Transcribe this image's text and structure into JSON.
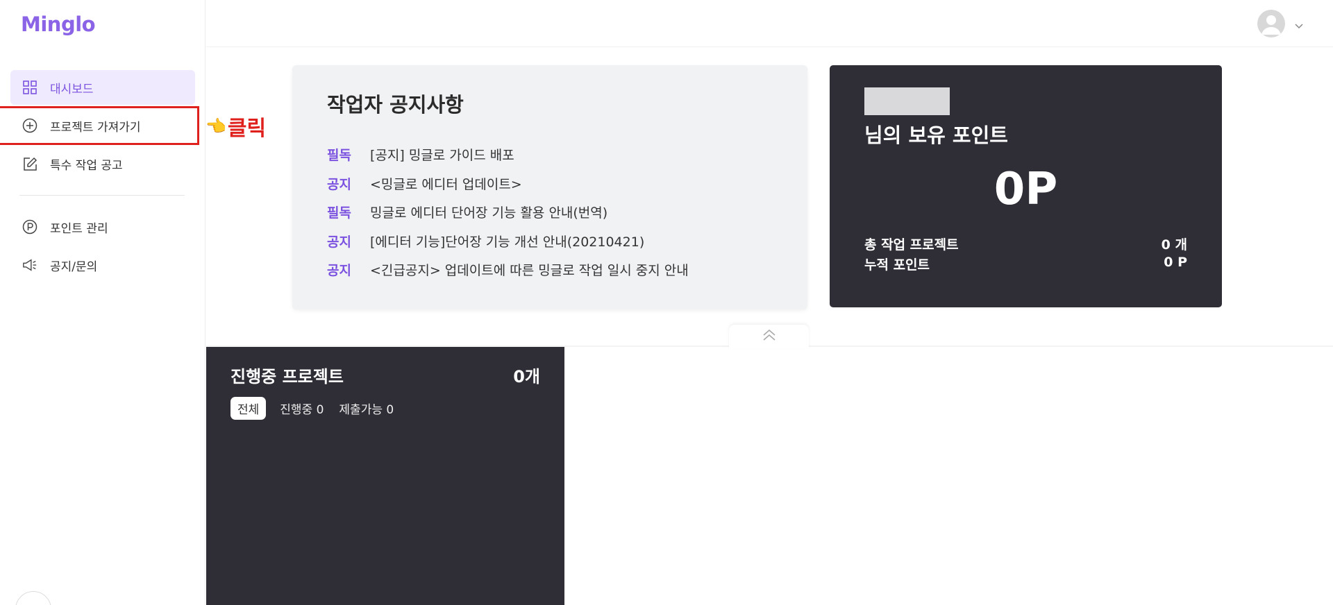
{
  "app": {
    "logo": "Minglo"
  },
  "sidebar": {
    "items": [
      {
        "label": "대시보드",
        "icon": "grid-icon"
      },
      {
        "label": "프로젝트 가져가기",
        "icon": "plus-circle-icon"
      },
      {
        "label": "특수 작업 공고",
        "icon": "edit-icon"
      },
      {
        "label": "포인트 관리",
        "icon": "p-circle-icon"
      },
      {
        "label": "공지/문의",
        "icon": "megaphone-icon"
      }
    ]
  },
  "annotation": {
    "hand": "👈",
    "label": "클릭",
    "color": "#e0201d"
  },
  "notices": {
    "title": "작업자 공지사항",
    "items": [
      {
        "tag": "필독",
        "text": "[공지] 밍글로 가이드 배포"
      },
      {
        "tag": "공지",
        "text": "<밍글로 에디터 업데이트>"
      },
      {
        "tag": "필독",
        "text": "밍글로 에디터 단어장 기능 활용 안내(번역)"
      },
      {
        "tag": "공지",
        "text": "[에디터 기능]단어장 기능 개선 안내(20210421)"
      },
      {
        "tag": "공지",
        "text": "<긴급공지> 업데이트에 따른 밍글로 작업 일시 중지 안내"
      }
    ]
  },
  "points": {
    "title": "님의 보유 포인트",
    "value": "0P",
    "rows": [
      {
        "label": "총 작업 프로젝트",
        "value": "0 개"
      },
      {
        "label": "누적 포인트",
        "value": "0 P"
      }
    ]
  },
  "progress": {
    "title": "진행중 프로젝트",
    "count": "0개",
    "filters": [
      "전체",
      "진행중 0",
      "제출가능 0"
    ]
  },
  "colors": {
    "accent": "#7b52e0",
    "dark_panel": "#2f2e36",
    "highlight_border": "#e0201d"
  }
}
